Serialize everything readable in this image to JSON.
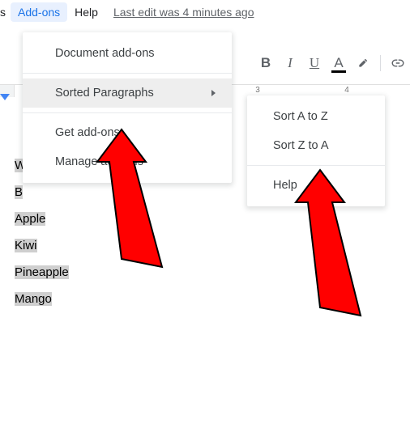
{
  "menubar": {
    "cut_item": "s",
    "addons": "Add-ons",
    "help": "Help",
    "last_edit": "Last edit was 4 minutes ago"
  },
  "dropdown": {
    "doc_addons": "Document add-ons",
    "sorted_paragraphs": "Sorted Paragraphs",
    "get_addons": "Get add-ons",
    "manage_addons": "Manage add-ons"
  },
  "submenu": {
    "sort_az": "Sort A to Z",
    "sort_za": "Sort Z to A",
    "help": "Help"
  },
  "toolbar": {
    "bold": "B",
    "italic": "I",
    "underline": "U",
    "textcolor": "A"
  },
  "ruler": {
    "n3": "3",
    "n4": "4"
  },
  "doc": {
    "w1": "W",
    "w2": "B",
    "apple": "Apple",
    "kiwi": "Kiwi",
    "pineapple": "Pineapple",
    "mango": "Mango"
  }
}
